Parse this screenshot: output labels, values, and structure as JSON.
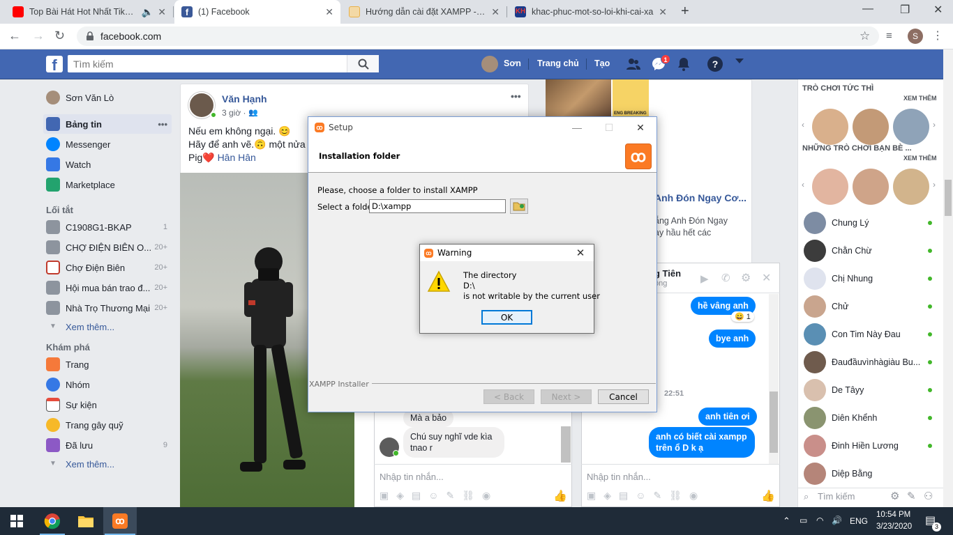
{
  "browser": {
    "tabs": [
      {
        "title": "Top Bài Hát Hot Nhất TikTok",
        "color": "#ff0000"
      },
      {
        "title": "(1) Facebook",
        "color": "#3b5998"
      },
      {
        "title": "Hướng dẫn cài đặt XAMPP - MyS",
        "color": "#e8b04a"
      },
      {
        "title": "khac-phuc-mot-so-loi-khi-cai-xa",
        "color": "#1a3a8a"
      }
    ],
    "new_tab": "+",
    "url": "facebook.com",
    "profile_initial": "S"
  },
  "facebook": {
    "search_placeholder": "Tìm kiếm",
    "nav": {
      "user": "Sơn",
      "home": "Trang chủ",
      "create": "Tạo",
      "messenger_badge": "1"
    },
    "left": {
      "profile": "Sơn Văn Lò",
      "main": [
        {
          "label": "Bảng tin",
          "more": "•••"
        },
        {
          "label": "Messenger"
        },
        {
          "label": "Watch"
        },
        {
          "label": "Marketplace"
        }
      ],
      "shortcuts_title": "Lối tắt",
      "shortcuts": [
        {
          "label": "C1908G1-BKAP",
          "count": "1"
        },
        {
          "label": "CHỢ ĐIỆN BIÊN O...",
          "count": "20+"
        },
        {
          "label": "Chợ Điện Biên",
          "count": "20+"
        },
        {
          "label": "Hội mua bán trao đ...",
          "count": "20+"
        },
        {
          "label": "Nhà Trọ Thương Mại",
          "count": "20+"
        }
      ],
      "see_more_1": "Xem thêm...",
      "explore_title": "Khám phá",
      "explore": [
        {
          "label": "Trang",
          "count": ""
        },
        {
          "label": "Nhóm",
          "count": ""
        },
        {
          "label": "Sự kiện",
          "count": ""
        },
        {
          "label": "Trang gây quỹ",
          "count": ""
        },
        {
          "label": "Đã lưu",
          "count": "9"
        }
      ],
      "see_more_2": "Xem thêm..."
    },
    "post": {
      "author": "Văn Hạnh",
      "time": "3 giờ ·",
      "line1": "Nếu em không ngại. 😊",
      "line2": "Hãy để anh vẽ.🙃 một nửa",
      "line3_prefix": "Pig❤️",
      "line3_tag": "Hân Hân",
      "more": "•••"
    },
    "card2": {
      "headline": "Anh Đón Ngay Cơ...",
      "line1": "ẵng Anh Đón Ngay",
      "line2": "ay hầu hết các",
      "thumb_caption": "ENG BREAKING"
    },
    "chat1": {
      "messages": [
        "Mà a bảo",
        "Chú suy nghĩ vde kìa tnao r"
      ],
      "placeholder": "Nhập tin nhắn..."
    },
    "chat2": {
      "name": "g Tiên",
      "status": "ộng",
      "messages": [
        {
          "text": "hề vâng anh",
          "me": true
        },
        {
          "text": "bye anh",
          "me": true
        },
        {
          "text": "anh tiên ơi",
          "me": true
        },
        {
          "text": "anh có biết cài xampp trên ổ D  k ạ",
          "me": true
        }
      ],
      "reaction": "😄 1",
      "time": "22:51",
      "placeholder": "Nhập tin nhắn..."
    },
    "right": {
      "games_title": "TRÒ CHƠI TỨC THÌ",
      "see_all_1": "XEM THÊM",
      "friends_games_title": "NHỮNG TRÒ CHƠI BẠN BÈ ...",
      "see_all_2": "XEM THÊM",
      "contacts": [
        "Chung Lý",
        "Chằn Chừ",
        "Chị Nhung",
        "Chử",
        "Con Tim Này Đau",
        "Đauđầuvìnhàgiàu Bu...",
        "De Tâyy",
        "Diên Khểnh",
        "Đinh Hiền Lương",
        "Diệp Bằng"
      ],
      "search_placeholder": "Tìm kiếm"
    }
  },
  "setup_dialog": {
    "title": "Setup",
    "header": "Installation folder",
    "instruction": "Please, choose a folder to install XAMPP",
    "folder_label": "Select a folder",
    "folder_value": "D:\\xampp",
    "footer_label": "XAMPP Installer",
    "back": "< Back",
    "next": "Next >",
    "cancel": "Cancel"
  },
  "warning_dialog": {
    "title": "Warning",
    "line1": "The directory",
    "line2": "D:\\",
    "line3": "is not writable by the current user",
    "ok": "OK"
  },
  "taskbar": {
    "lang": "ENG",
    "time": "10:54 PM",
    "date": "3/23/2020",
    "notif_count": "3"
  },
  "colors": {
    "fb_blue": "#4267b2",
    "messenger_blue": "#0084ff",
    "online": "#42b72a",
    "xampp_orange": "#fb7a24",
    "taskbar": "#1f2b38"
  }
}
